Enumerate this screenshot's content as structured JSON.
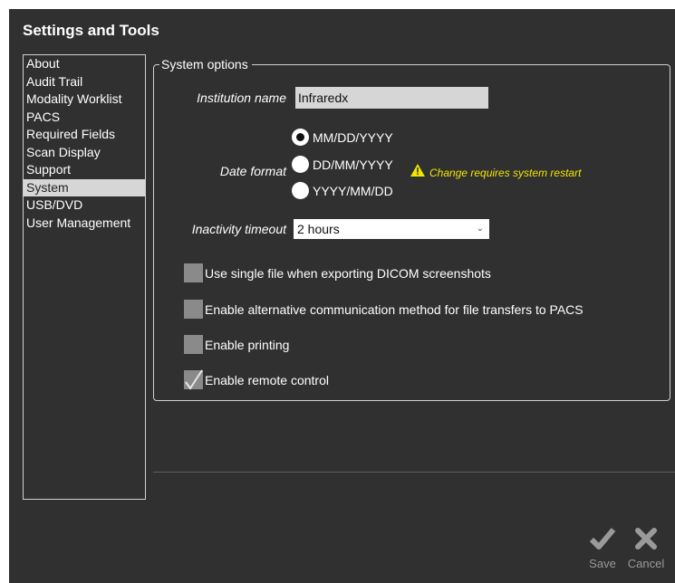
{
  "window": {
    "title": "Settings and Tools"
  },
  "sidebar": {
    "items": [
      {
        "label": "About"
      },
      {
        "label": "Audit Trail"
      },
      {
        "label": "Modality Worklist"
      },
      {
        "label": "PACS"
      },
      {
        "label": "Required Fields"
      },
      {
        "label": "Scan Display"
      },
      {
        "label": "Support"
      },
      {
        "label": "System",
        "selected": true
      },
      {
        "label": "USB/DVD"
      },
      {
        "label": "User Management"
      }
    ]
  },
  "system_options": {
    "group_title": "System options",
    "institution_label": "Institution name",
    "institution_value": "Infraredx",
    "date_format_label": "Date format",
    "date_formats": [
      {
        "label": "MM/DD/YYYY",
        "checked": true
      },
      {
        "label": "DD/MM/YYYY",
        "checked": false
      },
      {
        "label": "YYYY/MM/DD",
        "checked": false
      }
    ],
    "date_warning": "Change requires system restart",
    "warning_icon": "warning-triangle-icon",
    "inactivity_label": "Inactivity timeout",
    "inactivity_value": "2 hours",
    "checkboxes": [
      {
        "label": "Use single file when exporting DICOM screenshots",
        "checked": false
      },
      {
        "label": "Enable alternative communication method for file transfers to PACS",
        "checked": false
      },
      {
        "label": "Enable printing",
        "checked": false
      },
      {
        "label": "Enable remote control",
        "checked": true
      }
    ]
  },
  "actions": {
    "save_label": "Save",
    "save_icon": "checkmark-icon",
    "cancel_label": "Cancel",
    "cancel_icon": "x-icon"
  },
  "colors": {
    "background": "#303030",
    "selected": "#d6d6d6",
    "warning": "#f2e600",
    "disabled_text": "#9a9a9a"
  }
}
